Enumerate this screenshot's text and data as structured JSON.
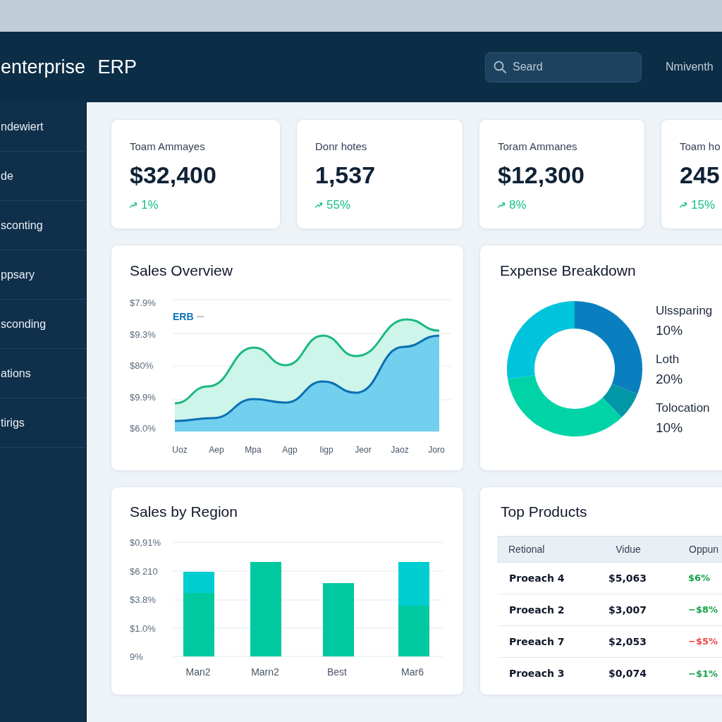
{
  "header": {
    "title": "enterprise ERP",
    "search": {
      "placeholder": "Seard"
    },
    "user_label": "Nmiventh"
  },
  "sidebar": {
    "items": [
      {
        "label": "ndewiert",
        "selected": false
      },
      {
        "label": "de",
        "selected": false
      },
      {
        "label": "sconting",
        "selected": false
      },
      {
        "label": "ppsary",
        "selected": false
      },
      {
        "label": "sconding",
        "selected": false
      },
      {
        "label": "ations",
        "selected": false
      },
      {
        "label": "tirigs",
        "selected": false
      }
    ]
  },
  "stats": [
    {
      "label": "Toam Ammayes",
      "value": "$32,400",
      "change": "1%"
    },
    {
      "label": "Donr hotes",
      "value": "1,537",
      "change": "55%"
    },
    {
      "label": "Toram Ammanes",
      "value": "$12,300",
      "change": "8%"
    },
    {
      "label": "Toam ho",
      "value": "245",
      "change": "15%"
    }
  ],
  "sales_overview": {
    "title": "Sales Overview",
    "legend": "ERB",
    "y_labels": [
      "$7.9%",
      "$9.3%",
      "$80%",
      "$9.9%",
      "$6.0%"
    ],
    "x_labels": [
      "Uoz",
      "Aep",
      "Mpa",
      "Agp",
      "Iigp",
      "Jeor",
      "Jaoz",
      "Joro"
    ]
  },
  "expense_breakdown": {
    "title": "Expense Breakdown",
    "legend": [
      {
        "label": "Ulssparing",
        "value": "10%"
      },
      {
        "label": "Loth",
        "value": "20%"
      },
      {
        "label": "Tolocation",
        "value": "10%"
      }
    ]
  },
  "sales_by_region": {
    "title": "Sales by Region",
    "y_labels": [
      "$0,91%",
      "$6 210",
      "$3.8%",
      "$1.0%",
      "9%"
    ],
    "x_labels": [
      "Man2",
      "Marn2",
      "Best",
      "Mar6"
    ]
  },
  "top_products": {
    "title": "Top Products",
    "columns": [
      "Retional",
      "Vidue",
      "Oppun"
    ],
    "rows": [
      {
        "cells": [
          "Proeach 4",
          "$5,063",
          "$6%"
        ],
        "color": "#16a34a"
      },
      {
        "cells": [
          "Proeach 2",
          "$3,007",
          "−$8%"
        ],
        "color": "#16a34a"
      },
      {
        "cells": [
          "Preeach 7",
          "$2,053",
          "−$5%"
        ],
        "color": "#ef4444"
      },
      {
        "cells": [
          "Proeach 3",
          "$0,074",
          "−$1%"
        ],
        "color": "#16a34a"
      }
    ]
  }
}
